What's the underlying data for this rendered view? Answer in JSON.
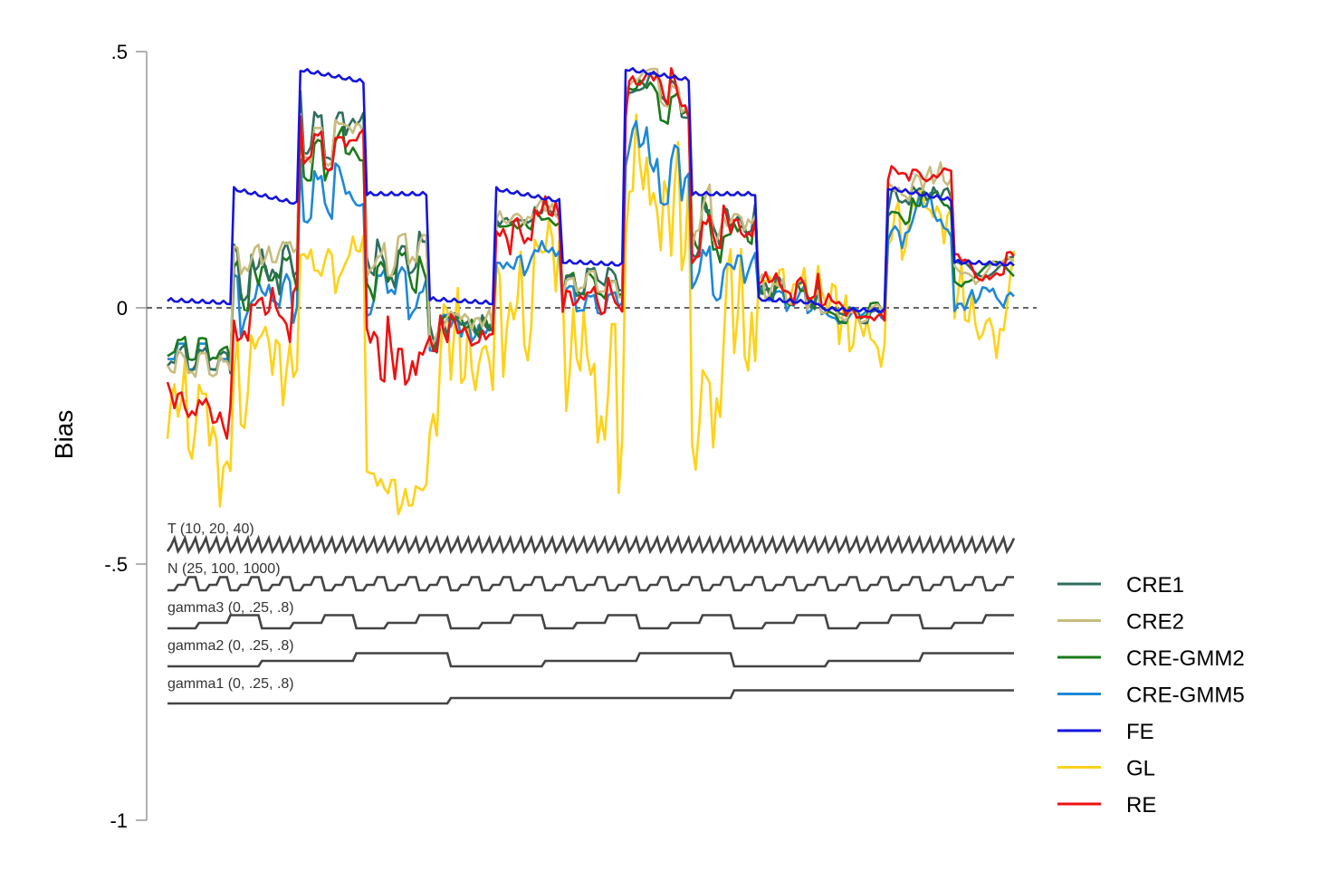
{
  "chart_data": {
    "type": "line",
    "ylabel": "Bias",
    "ylim": [
      -1,
      0.5
    ],
    "yticks": [
      {
        "value": 0.5,
        "label": ".5"
      },
      {
        "value": 0,
        "label": "0"
      },
      {
        "value": -0.5,
        "label": "-.5"
      },
      {
        "value": -1,
        "label": "-1"
      }
    ],
    "reference_line": 0,
    "legend_placement": "right",
    "n_points": 243,
    "series": [
      {
        "name": "CRE1",
        "color": "#2E6E5E",
        "segments": [
          [
            -0.11,
            -0.08,
            -0.12,
            -0.09
          ],
          [
            0.09,
            0.06,
            0.11,
            0.02
          ],
          [
            0.35,
            0.4,
            0.3,
            0.38
          ],
          [
            0.1,
            0.07,
            0.12,
            0.06
          ],
          [
            -0.02,
            -0.03,
            -0.04,
            -0.06
          ],
          [
            0.19,
            0.18,
            0.17,
            0.17
          ],
          [
            0.05,
            0.03,
            0.07,
            0.04
          ],
          [
            0.43,
            0.44,
            0.39,
            0.42
          ],
          [
            0.17,
            0.15,
            0.19,
            0.12
          ],
          [
            0.05,
            0.03,
            0.05,
            0.01
          ],
          [
            -0.01,
            -0.02,
            0.0,
            -0.01
          ],
          [
            0.24,
            0.23,
            0.21,
            0.2
          ],
          [
            0.08,
            0.07,
            0.08,
            0.08
          ]
        ]
      },
      {
        "name": "CRE2",
        "color": "#C8BC7E",
        "segments": [
          [
            -0.12,
            -0.09,
            -0.13,
            -0.1
          ],
          [
            0.11,
            0.1,
            0.12,
            0.07
          ],
          [
            0.34,
            0.38,
            0.29,
            0.36
          ],
          [
            0.11,
            0.08,
            0.13,
            0.07
          ],
          [
            -0.01,
            -0.02,
            -0.03,
            -0.05
          ],
          [
            0.2,
            0.19,
            0.18,
            0.17
          ],
          [
            0.04,
            0.03,
            0.06,
            0.03
          ],
          [
            0.44,
            0.45,
            0.4,
            0.43
          ],
          [
            0.18,
            0.16,
            0.2,
            0.13
          ],
          [
            0.05,
            0.03,
            0.05,
            0.01
          ],
          [
            -0.01,
            -0.02,
            0.0,
            -0.01
          ],
          [
            0.26,
            0.25,
            0.23,
            0.22
          ],
          [
            0.08,
            0.07,
            0.08,
            0.07
          ]
        ]
      },
      {
        "name": "CRE-GMM2",
        "color": "#1A7A1A",
        "segments": [
          [
            -0.09,
            -0.06,
            -0.1,
            -0.08
          ],
          [
            0.07,
            0.05,
            0.09,
            0.01
          ],
          [
            0.3,
            0.36,
            0.26,
            0.33
          ],
          [
            0.08,
            0.05,
            0.09,
            0.04
          ],
          [
            -0.02,
            -0.03,
            -0.04,
            -0.06
          ],
          [
            0.18,
            0.17,
            0.16,
            0.16
          ],
          [
            0.04,
            0.02,
            0.06,
            0.03
          ],
          [
            0.42,
            0.43,
            0.38,
            0.41
          ],
          [
            0.16,
            0.14,
            0.18,
            0.11
          ],
          [
            0.04,
            0.03,
            0.04,
            0.01
          ],
          [
            -0.01,
            -0.02,
            0.0,
            -0.01
          ],
          [
            0.21,
            0.2,
            0.19,
            0.18
          ],
          [
            0.07,
            0.06,
            0.07,
            0.07
          ]
        ]
      },
      {
        "name": "CRE-GMM5",
        "color": "#1E88D8",
        "segments": [
          [
            -0.1,
            -0.07,
            -0.12,
            -0.1
          ],
          [
            0.03,
            0.0,
            0.05,
            -0.03
          ],
          [
            0.22,
            0.3,
            0.18,
            0.26
          ],
          [
            0.04,
            0.01,
            0.06,
            0.0
          ],
          [
            -0.03,
            -0.04,
            -0.05,
            -0.07
          ],
          [
            0.12,
            0.1,
            0.09,
            0.08
          ],
          [
            0.01,
            -0.01,
            0.03,
            0.0
          ],
          [
            0.33,
            0.3,
            0.22,
            0.26
          ],
          [
            0.09,
            0.07,
            0.12,
            0.04
          ],
          [
            0.03,
            0.02,
            0.03,
            0.0
          ],
          [
            -0.01,
            -0.02,
            -0.01,
            -0.02
          ],
          [
            0.19,
            0.17,
            0.16,
            0.14
          ],
          [
            0.04,
            0.02,
            0.02,
            0.01
          ]
        ]
      },
      {
        "name": "FE",
        "color": "#1414E0",
        "segments": [
          [
            0.015,
            0.013,
            0.011,
            0.009
          ],
          [
            0.232,
            0.222,
            0.212,
            0.203
          ],
          [
            0.465,
            0.458,
            0.45,
            0.441
          ],
          [
            0.222,
            0.222,
            0.222,
            0.222
          ],
          [
            0.017,
            0.014,
            0.011,
            0.009
          ],
          [
            0.232,
            0.224,
            0.216,
            0.208
          ],
          [
            0.09,
            0.088,
            0.086,
            0.084
          ],
          [
            0.466,
            0.46,
            0.452,
            0.444
          ],
          [
            0.222,
            0.222,
            0.222,
            0.222
          ],
          [
            0.017,
            0.014,
            0.011,
            0.009
          ],
          [
            -0.002,
            -0.004,
            -0.005,
            -0.006
          ],
          [
            0.234,
            0.226,
            0.218,
            0.21
          ],
          [
            0.09,
            0.088,
            0.086,
            0.084
          ]
        ]
      },
      {
        "name": "GL",
        "color": "#FFD21A",
        "segments": [
          [
            -0.2,
            -0.16,
            -0.26,
            -0.34
          ],
          [
            -0.06,
            -0.09,
            -0.12,
            -0.2
          ],
          [
            0.12,
            0.08,
            0.1,
            0.06
          ],
          [
            -0.3,
            -0.34,
            -0.36,
            -0.36
          ],
          [
            -0.05,
            -0.09,
            -0.12,
            -0.26
          ],
          [
            0.12,
            0.09,
            0.04,
            -0.06
          ],
          [
            -0.01,
            -0.05,
            -0.1,
            -0.26
          ],
          [
            0.3,
            0.2,
            0.16,
            0.02
          ],
          [
            0.01,
            -0.06,
            -0.12,
            -0.24
          ],
          [
            0.08,
            0.05,
            0.06,
            0.02
          ],
          [
            0.02,
            -0.03,
            -0.06,
            -0.09
          ],
          [
            0.21,
            0.2,
            0.17,
            0.12
          ],
          [
            0.06,
            0.02,
            -0.02,
            -0.05
          ]
        ]
      },
      {
        "name": "RE",
        "color": "#EE1111",
        "segments": [
          [
            -0.17,
            -0.18,
            -0.21,
            -0.23
          ],
          [
            0.01,
            0.02,
            -0.04,
            -0.06
          ],
          [
            0.32,
            0.36,
            0.28,
            0.34
          ],
          [
            0.0,
            -0.06,
            -0.1,
            -0.14
          ],
          [
            -0.03,
            -0.05,
            -0.07,
            -0.08
          ],
          [
            0.19,
            0.18,
            0.16,
            0.13
          ],
          [
            0.04,
            0.02,
            0.03,
            -0.01
          ],
          [
            0.45,
            0.44,
            0.4,
            0.4
          ],
          [
            0.16,
            0.14,
            0.17,
            0.11
          ],
          [
            0.06,
            0.06,
            0.05,
            0.02
          ],
          [
            0.01,
            -0.01,
            -0.01,
            -0.02
          ],
          [
            0.27,
            0.27,
            0.26,
            0.25
          ],
          [
            0.09,
            0.08,
            0.08,
            0.07
          ]
        ]
      }
    ],
    "design_indicators": [
      {
        "label": "T (10, 20, 40)",
        "period": 3,
        "block": 1
      },
      {
        "label": "N (25, 100, 1000)",
        "period": 9,
        "block": 3
      },
      {
        "label": "gamma3 (0, .25, .8)",
        "period": 27,
        "block": 9
      },
      {
        "label": "gamma2 (0, .25, .8)",
        "period": 81,
        "block": 27
      },
      {
        "label": "gamma1 (0, .25, .8)",
        "period": 243,
        "block": 81
      }
    ]
  }
}
